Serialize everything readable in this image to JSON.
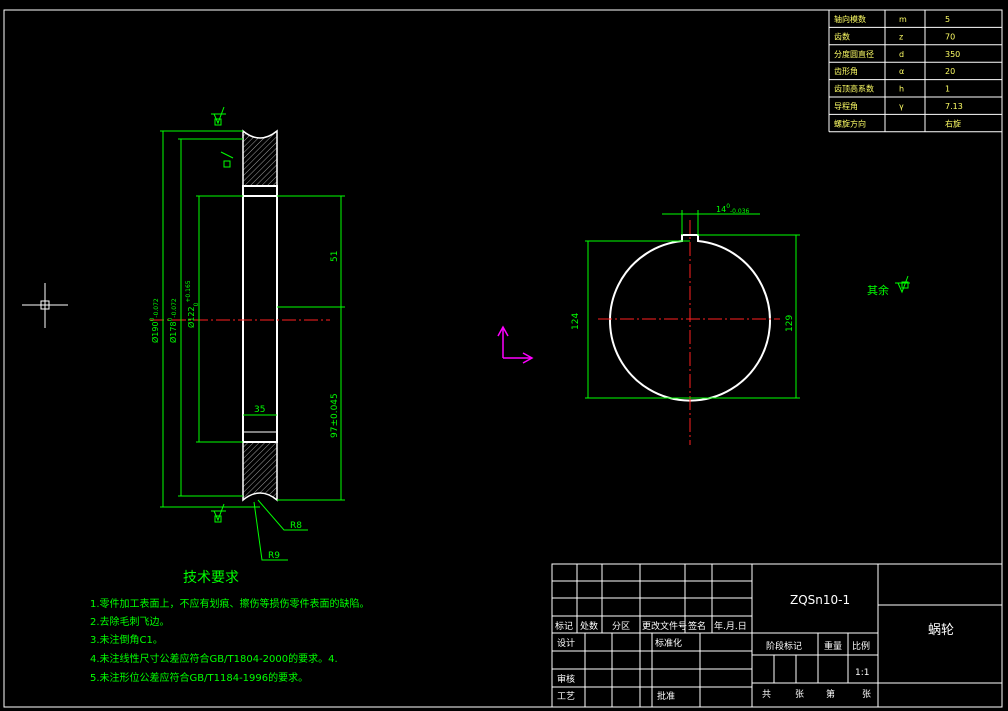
{
  "params_table": {
    "rows": [
      {
        "name": "轴向模数",
        "symbol": "m",
        "value": "5"
      },
      {
        "name": "齿数",
        "symbol": "z",
        "value": "70"
      },
      {
        "name": "分度圆直径",
        "symbol": "d",
        "value": "350"
      },
      {
        "name": "齿形角",
        "symbol": "α",
        "value": "20"
      },
      {
        "name": "齿顶高系数",
        "symbol": "h",
        "value": "1"
      },
      {
        "name": "导程角",
        "symbol": "γ",
        "value": "7.13"
      },
      {
        "name": "螺旋方向",
        "symbol": "",
        "value": "右旋"
      }
    ]
  },
  "dimensions": {
    "d1": "Ø190",
    "d1_tol": "0",
    "d1_tol_lo": "-0.072",
    "d2": "Ø178",
    "d2_tol": "0",
    "d2_tol_lo": "-0.072",
    "d3": "Ø122",
    "d3_tol": "0",
    "d3_tol_hi": "+0.165",
    "width": "35",
    "len_top": "51",
    "len_bottom": "97±0.045",
    "r_small": "R8",
    "r_big": "R9",
    "key_width": "14",
    "key_tol_hi": "0",
    "key_tol_lo": "-0.036",
    "bore": "124",
    "bore_key": "129",
    "rest": "其余"
  },
  "tech": {
    "title": "技术要求",
    "items": [
      "1.零件加工表面上，不应有划痕、擦伤等损伤零件表面的缺陷。",
      "2.去除毛刺飞边。",
      "3.未注倒角C1。",
      "4.未注线性尺寸公差应符合GB/T1804-2000的要求。4.",
      "5.未注形位公差应符合GB/T1184-1996的要求。"
    ]
  },
  "title_block": {
    "material": "ZQSn10-1",
    "part_name": "蜗轮",
    "hdr_mark": "标记",
    "hdr_count": "处数",
    "hdr_zone": "分区",
    "hdr_doc": "更改文件号",
    "hdr_sign": "签名",
    "hdr_date": "年.月.日",
    "design": "设计",
    "standard": "标准化",
    "stage": "阶段标记",
    "weight": "重量",
    "scale_label": "比例",
    "scale": "1:1",
    "review": "审核",
    "process": "工艺",
    "approve": "批准",
    "total": "共",
    "sheets": "张",
    "nth": "第",
    "sheets2": "张"
  }
}
